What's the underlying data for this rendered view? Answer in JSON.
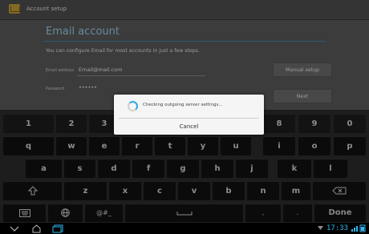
{
  "titlebar": {
    "title": "Account setup"
  },
  "page": {
    "heading": "Email account",
    "info": "You can configure Email for most accounts in just a few steps.",
    "email_label": "Email address",
    "email_value": "Email@mail.com",
    "password_label": "Password",
    "password_value": "••••••",
    "manual_setup": "Manual setup",
    "next": "Next"
  },
  "dialog": {
    "message": "Checking outgoing server settings...",
    "cancel": "Cancel"
  },
  "keyboard": {
    "row1": [
      "1",
      "2",
      "3",
      "4",
      "5",
      "6",
      "7",
      "8",
      "9",
      "0"
    ],
    "row2": [
      "q",
      "w",
      "e",
      "r",
      "t",
      "y",
      "u",
      "i",
      "o",
      "p"
    ],
    "row3": [
      "a",
      "s",
      "d",
      "f",
      "g",
      "h",
      "j",
      "k",
      "l"
    ],
    "row4": [
      "z",
      "x",
      "c",
      "v",
      "b",
      "n",
      "m"
    ],
    "symbols_label": "@#_",
    "comma": ",",
    "period": ".",
    "done": "Done"
  },
  "status": {
    "time": "17:33"
  },
  "colors": {
    "accent": "#35a7e3",
    "heading": "#9ed3f2"
  }
}
